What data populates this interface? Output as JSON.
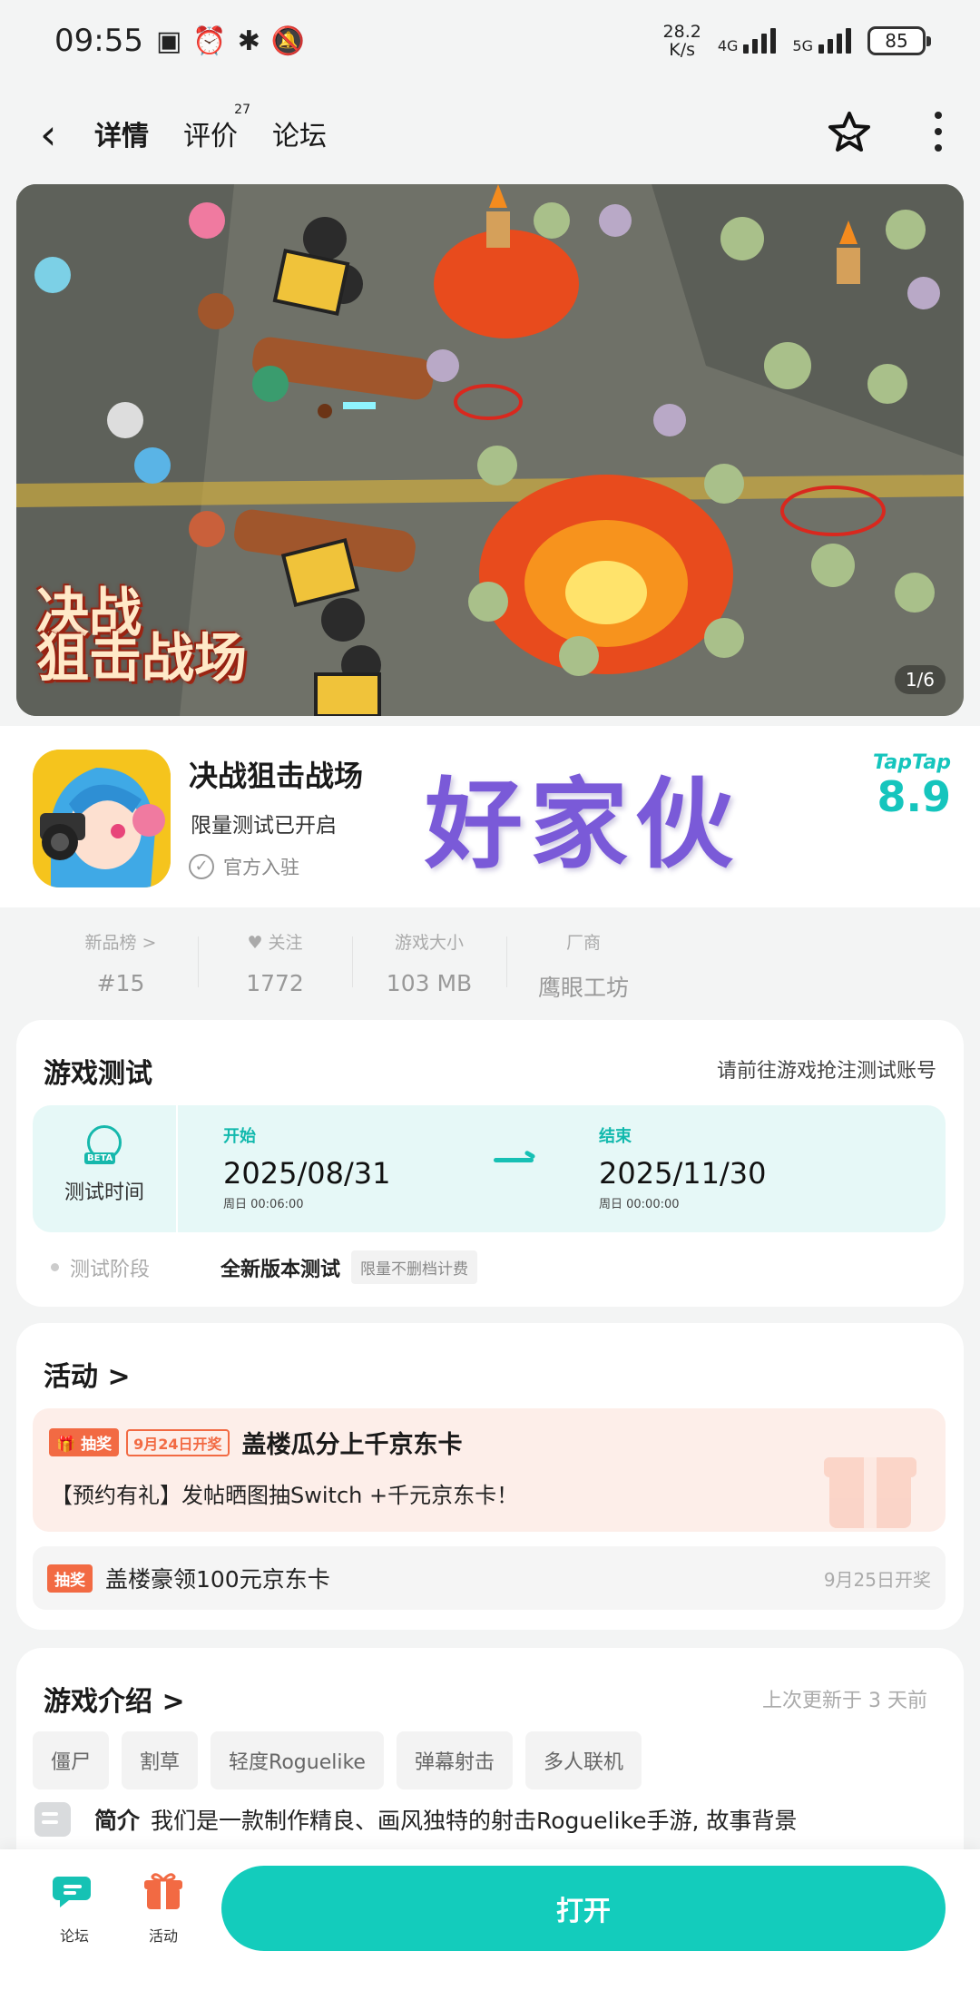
{
  "status_bar": {
    "time": "09:55",
    "speed_value": "28.2",
    "speed_unit": "K/s",
    "net1": "4G",
    "net2": "5G",
    "battery": "85"
  },
  "header": {
    "tabs": [
      {
        "label": "详情",
        "active": true
      },
      {
        "label": "评价",
        "count": "27"
      },
      {
        "label": "论坛"
      }
    ]
  },
  "banner": {
    "logo_line1": "决战",
    "logo_line2": "狙击战场",
    "page_indicator": "1/6"
  },
  "app": {
    "name": "决战狙击战场",
    "subtitle": "限量测试已开启",
    "official": "官方入驻",
    "watermark": "好家伙",
    "rating_brand": "TapTap",
    "rating": "8.9"
  },
  "stats": [
    {
      "label": "新品榜 >",
      "value": "#15"
    },
    {
      "label": "关注",
      "value": "1772"
    },
    {
      "label": "游戏大小",
      "value": "103 MB"
    },
    {
      "label": "厂商",
      "value": "鹰眼工坊"
    }
  ],
  "test": {
    "title": "游戏测试",
    "hint": "请前往游戏抢注测试账号",
    "time_label": "测试时间",
    "beta": "BETA",
    "start_label": "开始",
    "start_date": "2025/08/31",
    "start_sub": "周日 00:06:00",
    "end_label": "结束",
    "end_date": "2025/11/30",
    "end_sub": "周日 00:00:00",
    "stage_label": "测试阶段",
    "stage_value": "全新版本测试",
    "stage_tag": "限量不删档计费"
  },
  "activity": {
    "title": "活动 >",
    "main_badge": "抽奖",
    "main_date_badge": "9月24日开奖",
    "main_title": "盖楼瓜分上千京东卡",
    "main_desc": "【预约有礼】发帖晒图抽Switch +千元京东卡！",
    "sub_badge": "抽奖",
    "sub_title": "盖楼豪领100元京东卡",
    "sub_date": "9月25日开奖"
  },
  "intro": {
    "title": "游戏介绍 >",
    "updated": "上次更新于 3 天前",
    "tags": [
      "僵尸",
      "割草",
      "轻度Roguelike",
      "弹幕射击",
      "多人联机"
    ],
    "text_label": "简介",
    "text": "我们是一款制作精良、画风独特的射击Roguelike手游, 故事背景"
  },
  "bottom": {
    "forum_label": "论坛",
    "activity_label": "活动",
    "open_label": "打开"
  },
  "colors": {
    "accent": "#13ccbc",
    "orange": "#f26a43",
    "watermark": "#7a5ad8"
  }
}
